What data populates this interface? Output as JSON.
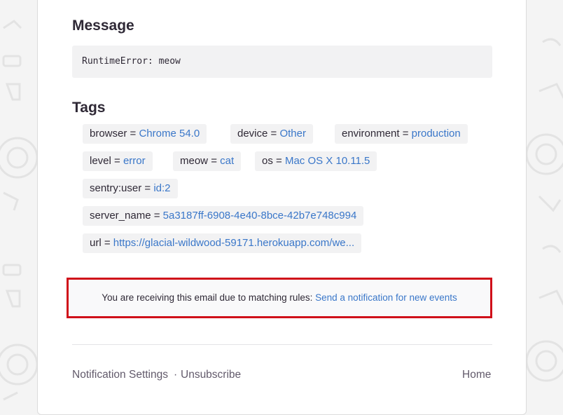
{
  "message": {
    "title": "Message",
    "text": "RuntimeError: meow"
  },
  "tags": {
    "title": "Tags",
    "items": [
      {
        "key": "browser",
        "value": "Chrome 54.0"
      },
      {
        "key": "device",
        "value": "Other"
      },
      {
        "key": "environment",
        "value": "production"
      },
      {
        "key": "level",
        "value": "error"
      },
      {
        "key": "meow",
        "value": "cat"
      },
      {
        "key": "os",
        "value": "Mac OS X 10.11.5"
      },
      {
        "key": "sentry:user",
        "value": "id:2"
      },
      {
        "key": "server_name",
        "value": "5a3187ff-6908-4e40-8bce-42b7e748c994"
      },
      {
        "key": "url",
        "value": "https://glacial-wildwood-59171.herokuapp.com/we..."
      }
    ],
    "equals": "="
  },
  "notice": {
    "text": "You are receiving this email due to matching rules:",
    "link": "Send a notification for new events"
  },
  "footer": {
    "notification_settings": "Notification Settings",
    "separator": "·",
    "unsubscribe": "Unsubscribe",
    "home": "Home"
  },
  "colors": {
    "link": "#3a77c9",
    "highlight_border": "#d0101a",
    "tag_background": "#f2f2f3"
  }
}
